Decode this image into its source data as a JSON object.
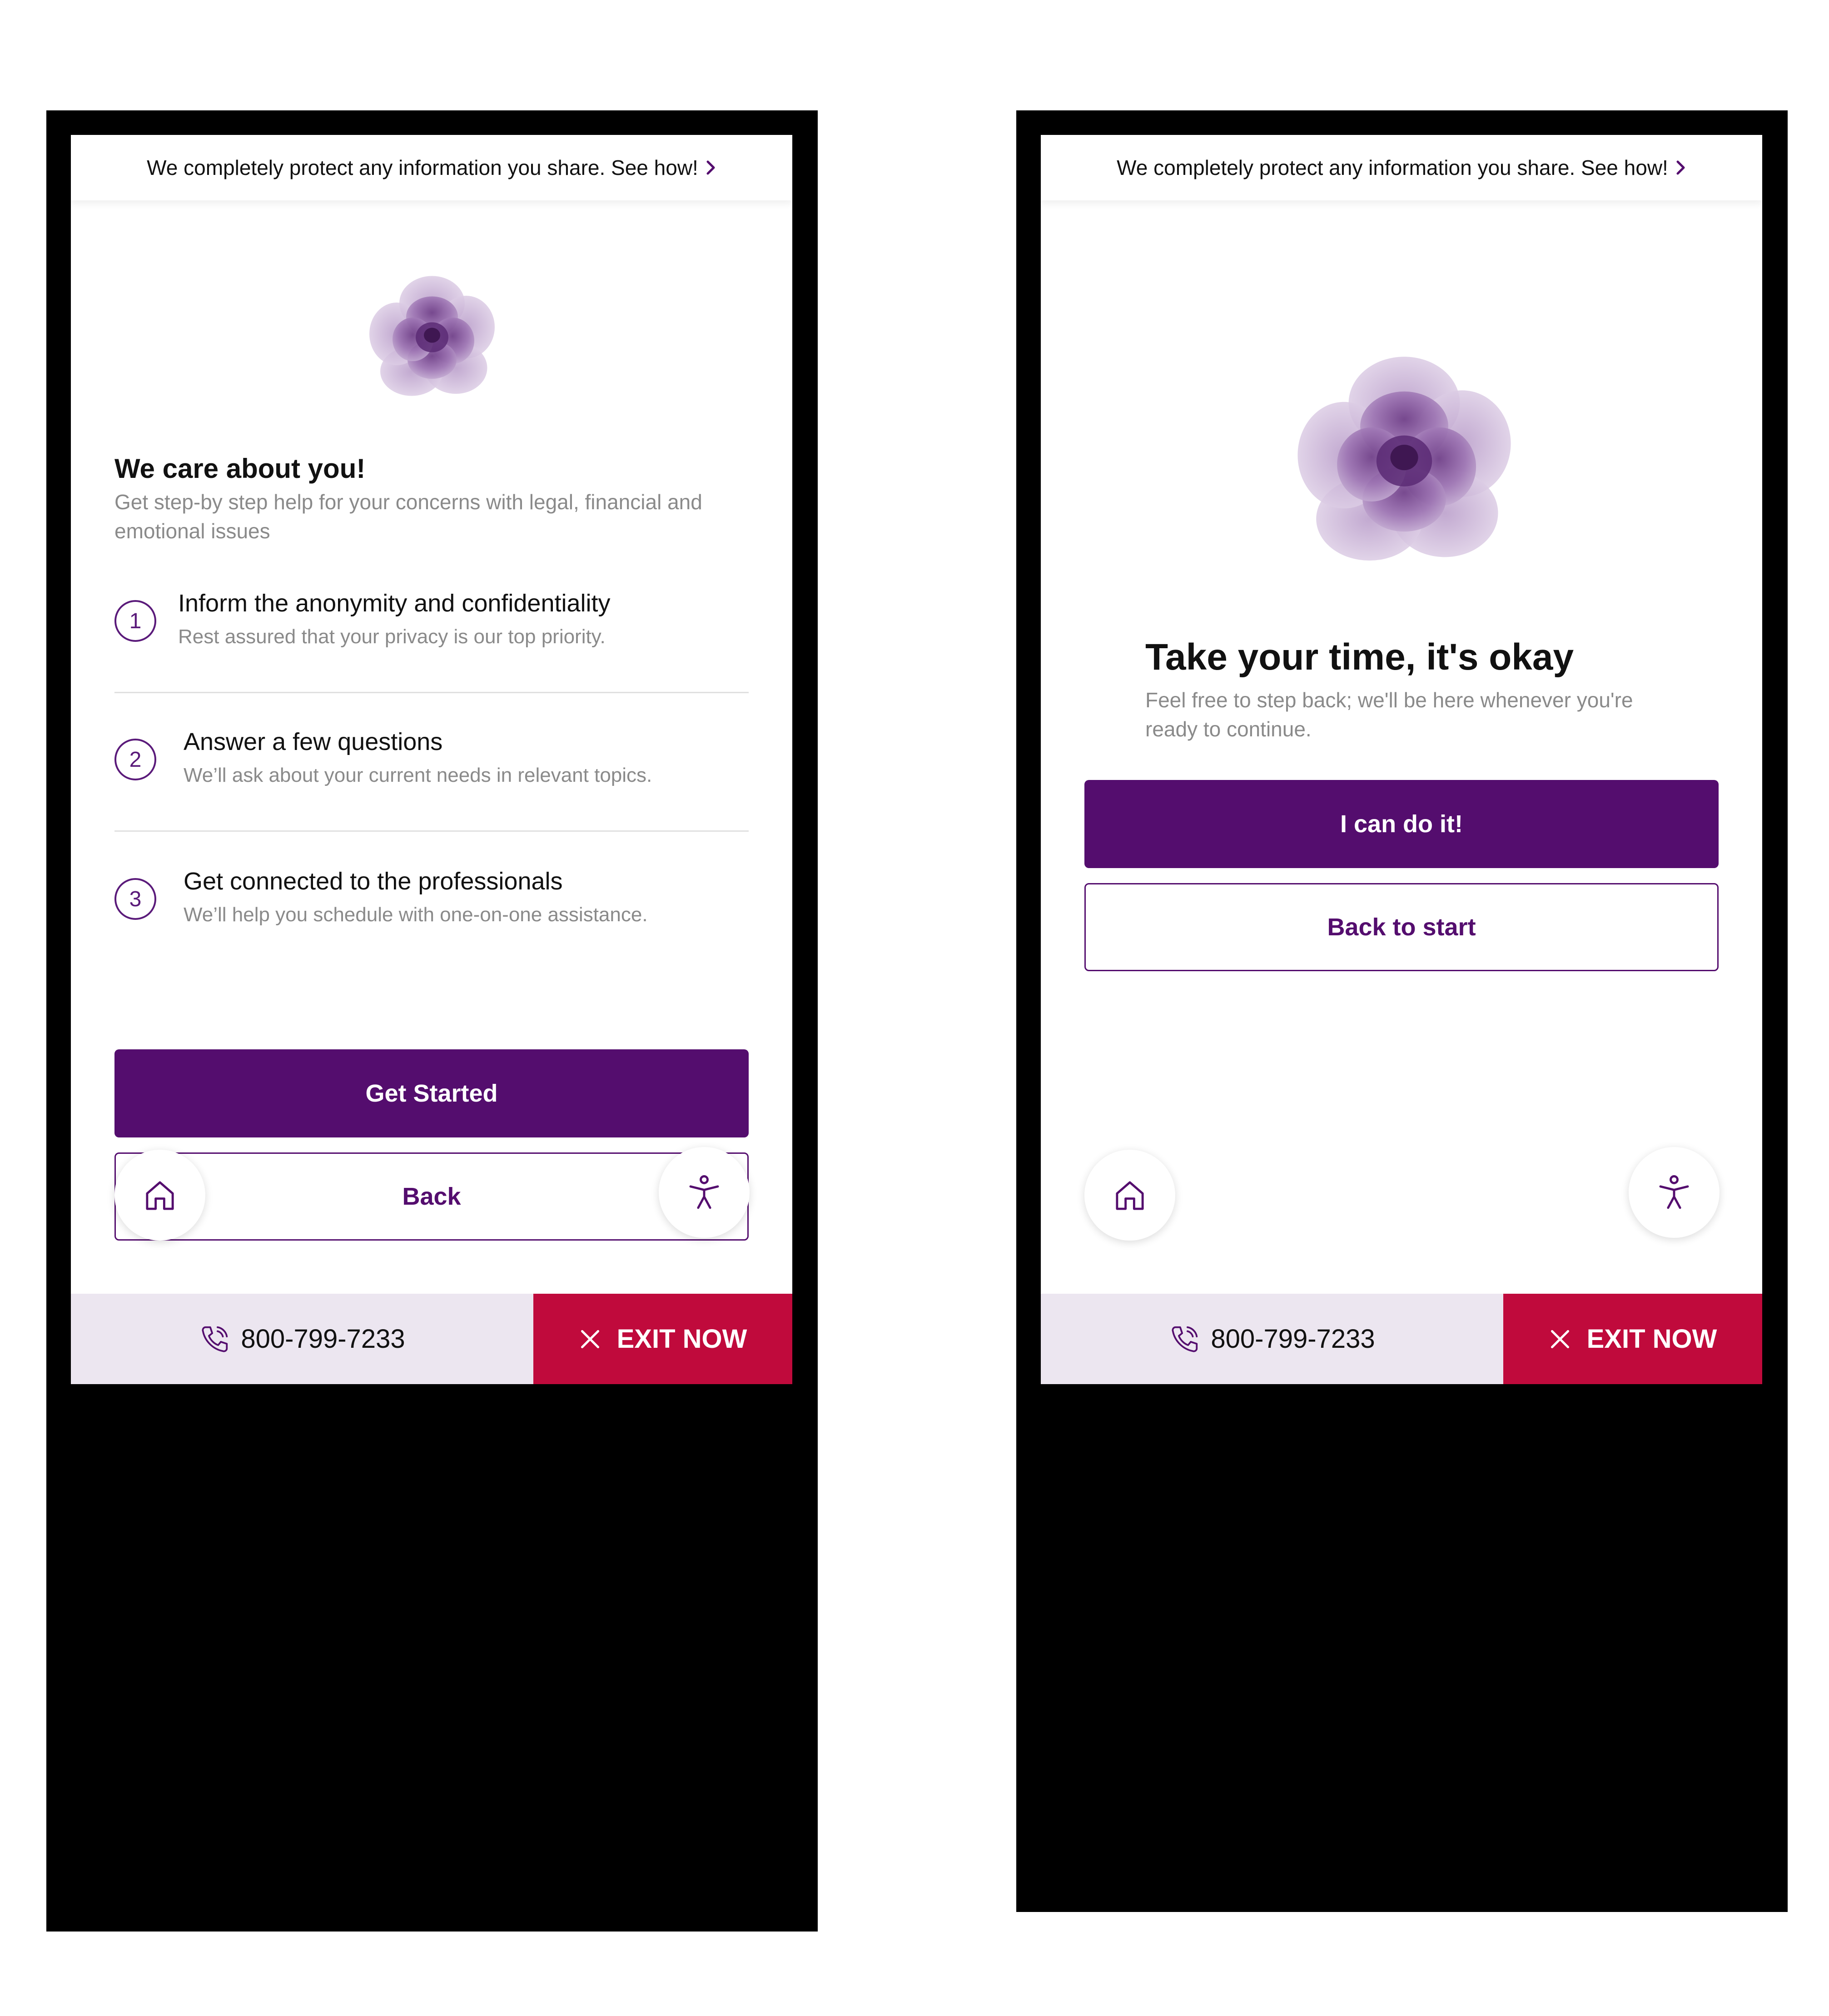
{
  "banner": {
    "text": "We completely protect any information you share. See how!"
  },
  "left_screen": {
    "title": "We care about you!",
    "subtitle": "Get step-by step help for your concerns with legal, financial and emotional issues",
    "steps": [
      {
        "number": "1",
        "title": "Inform the anonymity and confidentiality",
        "description": "Rest assured that your privacy is our top priority."
      },
      {
        "number": "2",
        "title": "Answer a few questions",
        "description": "We’ll ask about your current needs in relevant topics."
      },
      {
        "number": "3",
        "title": "Get connected to the professionals",
        "description": "We’ll help you schedule with one-on-one assistance."
      }
    ],
    "primary_button": "Get Started",
    "secondary_button": "Back"
  },
  "right_screen": {
    "title": "Take your time, it's okay",
    "subtitle": "Feel free to step back; we'll be here whenever you're ready to continue.",
    "primary_button": "I can do it!",
    "secondary_button": "Back to start"
  },
  "footer": {
    "phone": "800-799-7233",
    "exit": "EXIT NOW"
  },
  "icons": {
    "banner_chevron": "chevron-right-icon",
    "home": "home-icon",
    "accessibility": "accessibility-icon",
    "phone": "phone-icon",
    "exit": "close-icon",
    "flower": "flower-illustration"
  },
  "colors": {
    "brand_purple": "#540d6e",
    "exit_red": "#c00a3c",
    "footer_call_bg": "#ece6f0",
    "subtitle_gray": "#8a8a8a"
  }
}
